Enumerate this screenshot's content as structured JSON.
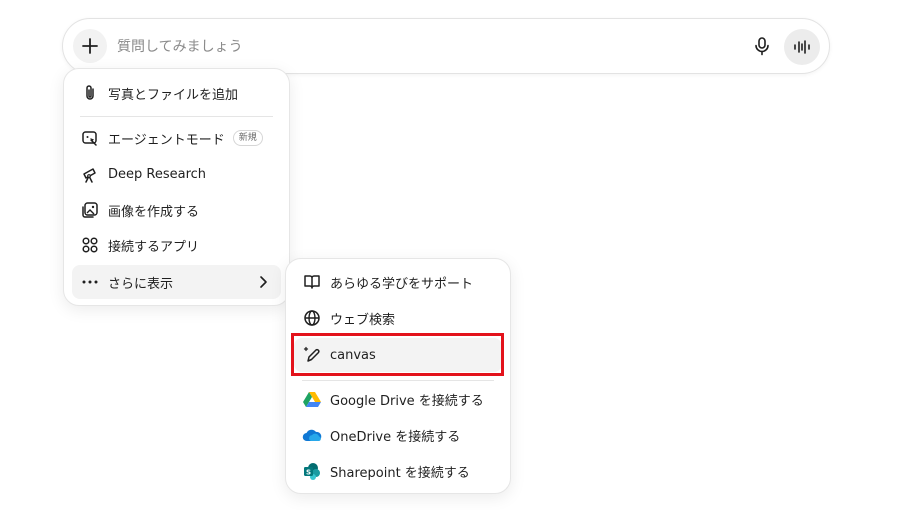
{
  "composer": {
    "placeholder": "質問してみましょう"
  },
  "main_menu": {
    "items": [
      {
        "label": "写真とファイルを追加",
        "icon": "paperclip-icon"
      },
      {
        "label": "エージェントモード",
        "icon": "agent-icon",
        "badge": "新規"
      },
      {
        "label": "Deep Research",
        "icon": "telescope-icon"
      },
      {
        "label": "画像を作成する",
        "icon": "image-icon"
      },
      {
        "label": "接続するアプリ",
        "icon": "apps-icon"
      },
      {
        "label": "さらに表示",
        "icon": "more-icon"
      }
    ]
  },
  "sub_menu": {
    "items": [
      {
        "label": "あらゆる学びをサポート",
        "icon": "book-icon"
      },
      {
        "label": "ウェブ検索",
        "icon": "globe-icon"
      },
      {
        "label": "canvas",
        "icon": "pencil-sparkle-icon"
      },
      {
        "label": "Google Drive を接続する",
        "icon": "google-drive-icon"
      },
      {
        "label": "OneDrive を接続する",
        "icon": "onedrive-icon"
      },
      {
        "label": "Sharepoint を接続する",
        "icon": "sharepoint-icon"
      }
    ]
  },
  "colors": {
    "highlight": "#e3121b",
    "drive_green": "#1ea362",
    "drive_yellow": "#ffba00",
    "drive_blue": "#4285f4",
    "onedrive_blue": "#0f78d4",
    "sharepoint_teal": "#036c70"
  }
}
